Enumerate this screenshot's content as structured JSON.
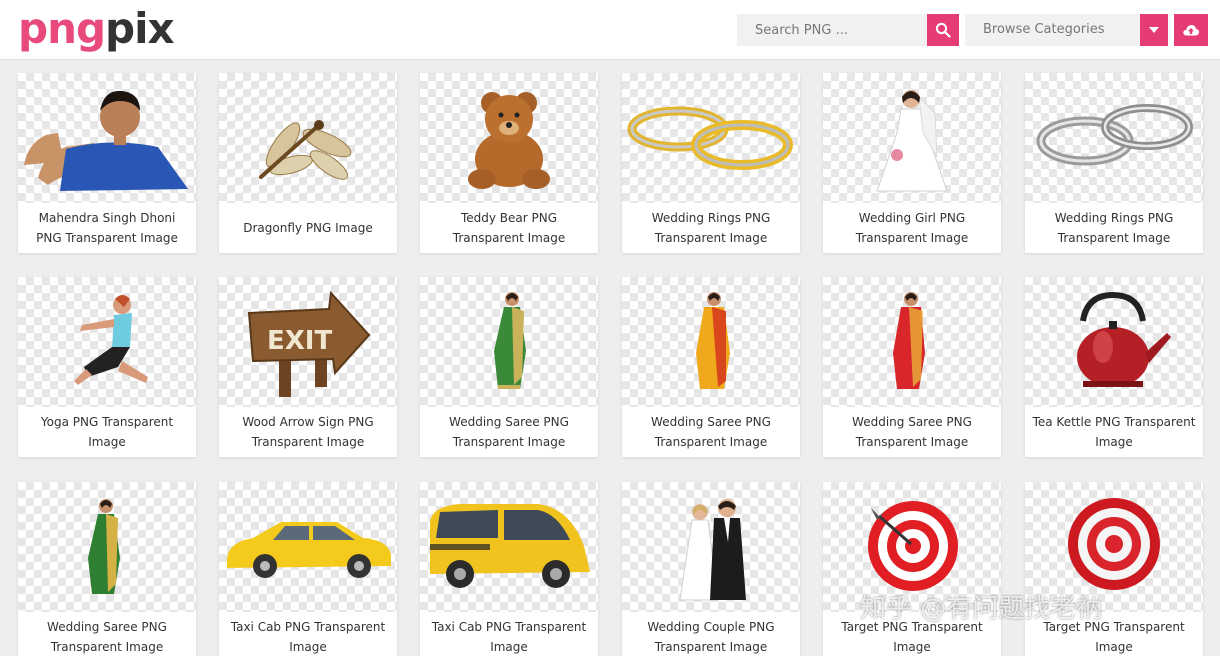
{
  "brand": {
    "part1": "png",
    "part2": "pix"
  },
  "header": {
    "search_placeholder": "Search PNG ...",
    "categories_label": "Browse Categories",
    "search_icon": "search-icon",
    "dropdown_icon": "caret-down-icon",
    "upload_icon": "cloud-upload-icon"
  },
  "colors": {
    "accent": "#e53c74",
    "logo_pink": "#e94a7c",
    "logo_dark": "#333333"
  },
  "items": [
    {
      "title": "Mahendra Singh Dhoni PNG Transparent Image",
      "icon": "man-flexing-image"
    },
    {
      "title": "Dragonfly PNG Image",
      "icon": "dragonfly-image"
    },
    {
      "title": "Teddy Bear PNG Transparent Image",
      "icon": "teddy-bear-image"
    },
    {
      "title": "Wedding Rings PNG Transparent Image",
      "icon": "gold-rings-image"
    },
    {
      "title": "Wedding Girl PNG Transparent Image",
      "icon": "bride-image"
    },
    {
      "title": "Wedding Rings PNG Transparent Image",
      "icon": "silver-rings-image"
    },
    {
      "title": "Yoga PNG Transparent Image",
      "icon": "yoga-woman-image"
    },
    {
      "title": "Wood Arrow Sign PNG Transparent Image",
      "icon": "wood-exit-sign-image",
      "sign_text": "EXIT"
    },
    {
      "title": "Wedding Saree PNG Transparent Image",
      "icon": "green-saree-image"
    },
    {
      "title": "Wedding Saree PNG Transparent Image",
      "icon": "yellow-saree-image"
    },
    {
      "title": "Wedding Saree PNG Transparent Image",
      "icon": "red-saree-image"
    },
    {
      "title": "Tea Kettle PNG Transparent Image",
      "icon": "red-kettle-image"
    },
    {
      "title": "Wedding Saree PNG Transparent Image",
      "icon": "green-saree-image"
    },
    {
      "title": "Taxi Cab PNG Transparent Image",
      "icon": "taxi-cab-image"
    },
    {
      "title": "Taxi Cab PNG Transparent Image",
      "icon": "taxi-van-image"
    },
    {
      "title": "Wedding Couple PNG Transparent Image",
      "icon": "wedding-couple-image"
    },
    {
      "title": "Target PNG Transparent Image",
      "icon": "target-dart-image"
    },
    {
      "title": "Target PNG Transparent Image",
      "icon": "target-image"
    }
  ],
  "watermark": "知乎 @有问题找老衲"
}
